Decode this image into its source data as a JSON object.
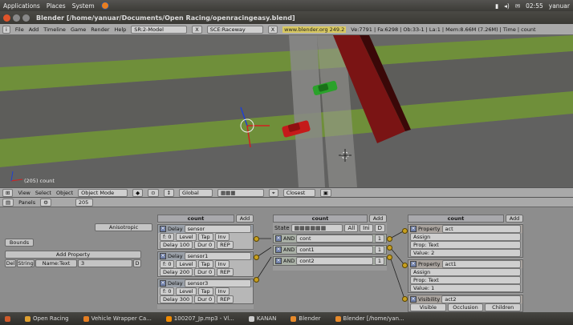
{
  "gnome_panel": {
    "menus": [
      "Applications",
      "Places",
      "System"
    ],
    "clock": "02:55",
    "user": "yanuar"
  },
  "window": {
    "title": "Blender [/home/yanuar/Documents/Open Racing/openracingeasy.blend]"
  },
  "menubar": {
    "menus": [
      "File",
      "Add",
      "Timeline",
      "Game",
      "Render",
      "Help"
    ],
    "screen": "SR:2-Model",
    "scene": "SCE:Raceway",
    "link": "www.blender.org 249.2",
    "stats": "Ve:7791 | Fa:6298 | Ob:33-1 | La:1 | Mem:8.66M (7.26M) | Time | count"
  },
  "viewport": {
    "overlay_label": "(205) count"
  },
  "view_header": {
    "menus": [
      "View",
      "Select",
      "Object"
    ],
    "mode": "Object Mode",
    "orientation": "Global",
    "snap": "Closest"
  },
  "logic_header": {
    "label": "Panels",
    "frame": "205"
  },
  "properties": {
    "anisotropic_label": "Anisotropic",
    "bounds_label": "Bounds",
    "add_property_label": "Add Property",
    "del_label": "Del",
    "type": "String",
    "name_field": "Name:Text",
    "value": "3",
    "d_label": "D"
  },
  "sensors": {
    "title": "count",
    "add_label": "Add",
    "items": [
      {
        "type": "Delay",
        "name": "sensor",
        "level": "Level",
        "tap": "Tap",
        "inv": "Inv",
        "delay": "Delay 100",
        "dur": "Dur 0",
        "rep": "REP",
        "freq": "f: 0"
      },
      {
        "type": "Delay",
        "name": "sensor1",
        "level": "Level",
        "tap": "Tap",
        "inv": "Inv",
        "delay": "Delay 200",
        "dur": "Dur 0",
        "rep": "REP",
        "freq": "f: 0"
      },
      {
        "type": "Delay",
        "name": "sensor3",
        "level": "Level",
        "tap": "Tap",
        "inv": "Inv",
        "delay": "Delay 300",
        "dur": "Dur 0",
        "rep": "REP",
        "freq": "f: 0"
      }
    ]
  },
  "controllers": {
    "title": "count",
    "add_label": "Add",
    "state_label": "State",
    "all_label": "All",
    "ini_label": "Ini",
    "d_label": "D",
    "items": [
      {
        "type": "AND",
        "name": "cont",
        "n": "1"
      },
      {
        "type": "AND",
        "name": "cont1",
        "n": "1"
      },
      {
        "type": "AND",
        "name": "cont2",
        "n": "1"
      }
    ]
  },
  "actuators": {
    "title": "count",
    "add_label": "Add",
    "items": [
      {
        "type": "Property",
        "name": "act",
        "mode": "Assign",
        "prop": "Prop: Text",
        "value": "Value: 2"
      },
      {
        "type": "Property",
        "name": "act1",
        "mode": "Assign",
        "prop": "Prop: Text",
        "value": "Value: 1"
      }
    ],
    "visibility": {
      "type": "Visibility",
      "name": "act2",
      "visible": "Visible",
      "occlusion": "Occlusion",
      "children": "Children"
    }
  },
  "taskbar": {
    "items": [
      "Open Racing",
      "Vehicle Wrapper Ca...",
      "100207_Jp.mp3 - Vl...",
      "KANAN",
      "Blender",
      "Blender [/home/yan..."
    ]
  },
  "colors": {
    "grass": "#6f8f3a",
    "road": "#5d5d5a",
    "car_red": "#c51a1a",
    "car_green": "#2aa22a",
    "wall": "#7a1414",
    "accent": "#c8a020"
  }
}
